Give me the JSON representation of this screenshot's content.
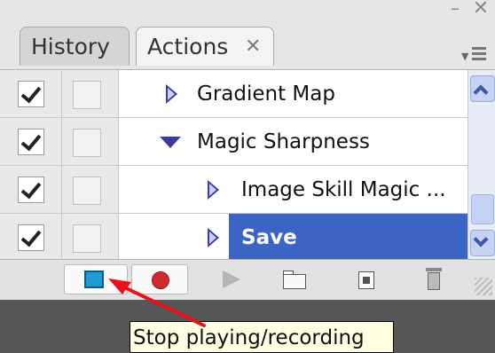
{
  "window": {
    "minimize_glyph": "–",
    "close_glyph": "✕"
  },
  "tabs": [
    {
      "label": "History",
      "active": false
    },
    {
      "label": "Actions",
      "active": true,
      "close_glyph": "✕"
    }
  ],
  "actions_list": [
    {
      "label": "Gradient Map",
      "checked": true,
      "disclosure": "collapsed",
      "indent": 1,
      "selected": false
    },
    {
      "label": "Magic Sharpness",
      "checked": true,
      "disclosure": "expanded",
      "indent": 1,
      "selected": false
    },
    {
      "label": "Image Skill Magic ...",
      "checked": true,
      "disclosure": "collapsed",
      "indent": 2,
      "selected": false
    },
    {
      "label": "Save",
      "checked": true,
      "disclosure": "collapsed",
      "indent": 2,
      "selected": true
    }
  ],
  "toolbar": {
    "buttons": [
      "stop-playing-recording",
      "begin-recording",
      "play-selection",
      "create-new-set",
      "create-new-action",
      "delete"
    ]
  },
  "tooltip": {
    "text": "Stop playing/recording"
  },
  "colors": {
    "selection": "#3c64c4",
    "record": "#d4282f",
    "stop": "#1e9ad6",
    "annotation_arrow": "#e8101a"
  }
}
